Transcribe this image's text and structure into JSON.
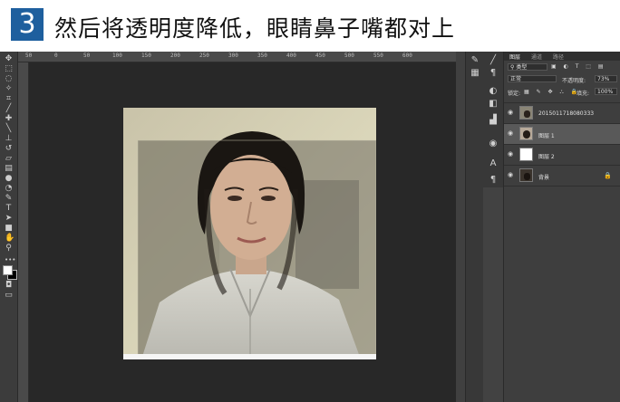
{
  "header": {
    "step_number": "3",
    "title": "然后将透明度降低，眼睛鼻子嘴都对上"
  },
  "ruler": {
    "top_numbers": [
      "50",
      "0",
      "50",
      "100",
      "150",
      "200",
      "250",
      "300",
      "350",
      "400",
      "450",
      "500",
      "550",
      "600"
    ]
  },
  "toolbar": {
    "tools": [
      "move-icon",
      "marquee-icon",
      "lasso-icon",
      "magic-wand-icon",
      "crop-icon",
      "eyedropper-icon",
      "healing-brush-icon",
      "brush-icon",
      "clone-stamp-icon",
      "history-brush-icon",
      "eraser-icon",
      "gradient-icon",
      "blur-icon",
      "dodge-icon",
      "pen-icon",
      "type-icon",
      "path-select-icon",
      "shape-icon",
      "hand-icon",
      "zoom-icon"
    ],
    "more": "•••"
  },
  "layers_panel": {
    "tabs": [
      "图层",
      "通道",
      "路径"
    ],
    "filter_kind": "类型",
    "blend_mode": "正常",
    "opacity_label": "不透明度:",
    "opacity_value": "73%",
    "lock_label": "锁定:",
    "fill_label": "填充:",
    "fill_value": "100%",
    "layers": [
      {
        "name": "2015011718080333",
        "active": false,
        "thumb": "photo"
      },
      {
        "name": "图层 1",
        "active": true,
        "thumb": "portrait"
      },
      {
        "name": "图层 2",
        "active": false,
        "thumb": "white"
      },
      {
        "name": "背景",
        "active": false,
        "thumb": "photo-small",
        "locked": true
      }
    ]
  },
  "colors": {
    "workspace": "#535353",
    "canvas_bg": "#282828",
    "badge": "#1e5f9e",
    "panel": "#3e3e3e"
  }
}
